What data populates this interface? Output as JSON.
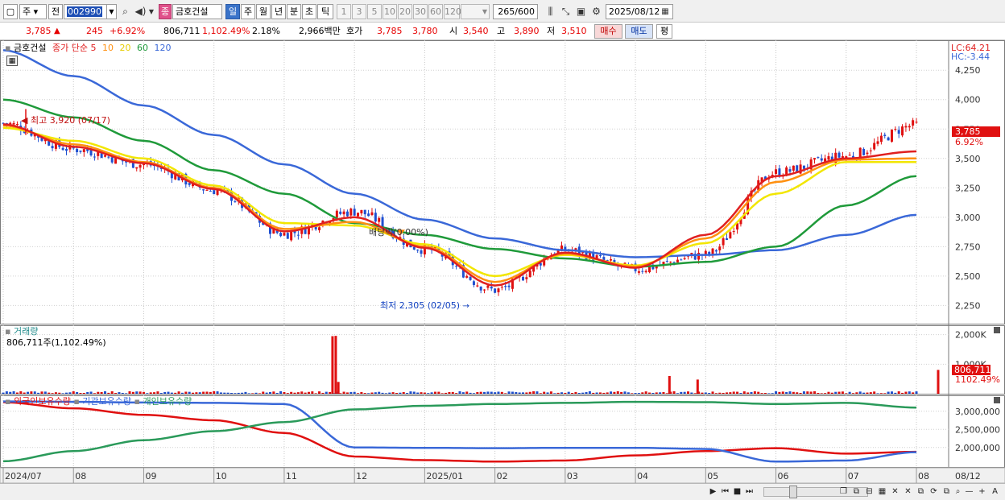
{
  "toolbar": {
    "market_label": "주",
    "prev_label": "전",
    "code": "002990",
    "name_badge": "종",
    "stock_name": "금호건설",
    "period_tabs": [
      "일",
      "주",
      "월",
      "년",
      "분",
      "초",
      "틱"
    ],
    "interval_tabs": [
      "1",
      "3",
      "5",
      "10",
      "20",
      "30",
      "60",
      "120"
    ],
    "count": "265",
    "count_max": "/600",
    "date": "2025/08/12"
  },
  "quote": {
    "price": "3,785",
    "arrow": "▲",
    "change": "245",
    "change_pct": "+6.92%",
    "volume": "806,711",
    "volume_pct": "1,102.49%",
    "turnover": "2.18%",
    "amount": "2,966백만",
    "hoga_label": "호가",
    "ask": "3,785",
    "bid": "3,780",
    "open_label": "시",
    "open": "3,540",
    "high_label": "고",
    "high": "3,890",
    "low_label": "저",
    "low": "3,510",
    "buy_label": "매수",
    "sell_label": "매도",
    "eval_label": "평"
  },
  "price_panel": {
    "legend_name": "금호건설",
    "legend_close": "종가",
    "legend_simple": "단순",
    "ma_labels": [
      "5",
      "10",
      "20",
      "60",
      "120"
    ],
    "lc": "LC:64.21",
    "hc": "HC:-3.44",
    "y_ticks": [
      "4,250",
      "4,000",
      "3,750",
      "3,500",
      "3,250",
      "3,000",
      "2,750",
      "2,500",
      "2,250"
    ],
    "current_price_tag": "3,785",
    "current_pct_tag": "6.92%",
    "high_annotation": "최고 3,920 (07/17)",
    "low_annotation": "최저 2,305 (02/05)",
    "dividend_annotation": "배당락(0.00%)"
  },
  "volume_panel": {
    "title": "거래량",
    "value": "806,711주(1,102.49%)",
    "y_ticks": [
      "2,000K",
      "1,000K"
    ],
    "current_tag": "806,711",
    "current_pct_tag": "1102.49%"
  },
  "holding_panel": {
    "legend": [
      "외국인보유수량",
      "기관보유수량",
      "개인보유수량"
    ],
    "y_ticks": [
      "3,000,000",
      "2,500,000",
      "2,000,000"
    ]
  },
  "x_axis": {
    "labels": [
      "2024/07",
      "08",
      "09",
      "10",
      "11",
      "12",
      "2025/01",
      "02",
      "03",
      "04",
      "05",
      "06",
      "07",
      "08"
    ],
    "right_label": "08/12"
  },
  "colors": {
    "candle_up": "#e01010",
    "candle_down": "#1e4fd0",
    "ma5": "#e02020",
    "ma10": "#ff9010",
    "ma20": "#f2e600",
    "ma60": "#1f9a3a",
    "ma120": "#3a68d8",
    "foreign": "#e01010",
    "institution": "#3a68d8",
    "individual": "#2a9a5a"
  },
  "chart_data": [
    {
      "type": "line",
      "title": "",
      "xlabel": "",
      "ylabel": "",
      "ylim": [
        2150,
        4450
      ],
      "categories": [
        "2024/07",
        "08",
        "09",
        "10",
        "11",
        "12",
        "2025/01",
        "02",
        "03",
        "04",
        "05",
        "06",
        "07",
        "08"
      ],
      "series": [
        {
          "name": "종가",
          "values": [
            3800,
            3580,
            3450,
            3230,
            2860,
            3050,
            2730,
            2380,
            2720,
            2560,
            2680,
            3380,
            3520,
            3785
          ]
        },
        {
          "name": "5",
          "values": [
            3790,
            3600,
            3460,
            3240,
            2880,
            3000,
            2740,
            2420,
            2700,
            2570,
            2850,
            3350,
            3500,
            3560
          ]
        },
        {
          "name": "10",
          "values": [
            3780,
            3620,
            3470,
            3250,
            2900,
            2960,
            2750,
            2450,
            2690,
            2580,
            2820,
            3300,
            3490,
            3500
          ]
        },
        {
          "name": "20",
          "values": [
            3760,
            3650,
            3500,
            3270,
            2950,
            2930,
            2770,
            2500,
            2680,
            2590,
            2780,
            3200,
            3470,
            3470
          ]
        },
        {
          "name": "60",
          "values": [
            4000,
            3850,
            3650,
            3400,
            3200,
            2950,
            2850,
            2730,
            2650,
            2580,
            2620,
            2750,
            3100,
            3350
          ]
        },
        {
          "name": "120",
          "values": [
            4420,
            4200,
            3950,
            3700,
            3450,
            3200,
            2980,
            2820,
            2720,
            2660,
            2680,
            2720,
            2850,
            3020
          ]
        }
      ]
    },
    {
      "type": "bar",
      "title": "거래량",
      "ylim": [
        0,
        2100000
      ],
      "categories": [
        "2024/07",
        "08",
        "09",
        "10",
        "11",
        "12",
        "2025/01",
        "02",
        "03",
        "04",
        "05",
        "06",
        "07",
        "08"
      ],
      "values": [
        70000,
        60000,
        50000,
        45000,
        1950000,
        90000,
        60000,
        55000,
        70000,
        50000,
        600000,
        80000,
        70000,
        806711
      ]
    },
    {
      "type": "line",
      "title": "",
      "ylim": [
        1550000,
        3350000
      ],
      "categories": [
        "2024/07",
        "08",
        "09",
        "10",
        "11",
        "12",
        "2025/01",
        "02",
        "03",
        "04",
        "05",
        "06",
        "07",
        "08"
      ],
      "series": [
        {
          "name": "외국인보유수량",
          "values": [
            3250000,
            3080000,
            2900000,
            2750000,
            2400000,
            1750000,
            1650000,
            1610000,
            1640000,
            1780000,
            1900000,
            1980000,
            1830000,
            1880000
          ]
        },
        {
          "name": "기관보유수량",
          "values": [
            3270000,
            3260000,
            3240000,
            3230000,
            3200000,
            2000000,
            1990000,
            1980000,
            1990000,
            1990000,
            1960000,
            1610000,
            1640000,
            1870000
          ]
        },
        {
          "name": "개인보유수량",
          "values": [
            1620000,
            1900000,
            2200000,
            2450000,
            2700000,
            3050000,
            3150000,
            3200000,
            3230000,
            3260000,
            3250000,
            3200000,
            3230000,
            3100000
          ]
        }
      ]
    }
  ]
}
